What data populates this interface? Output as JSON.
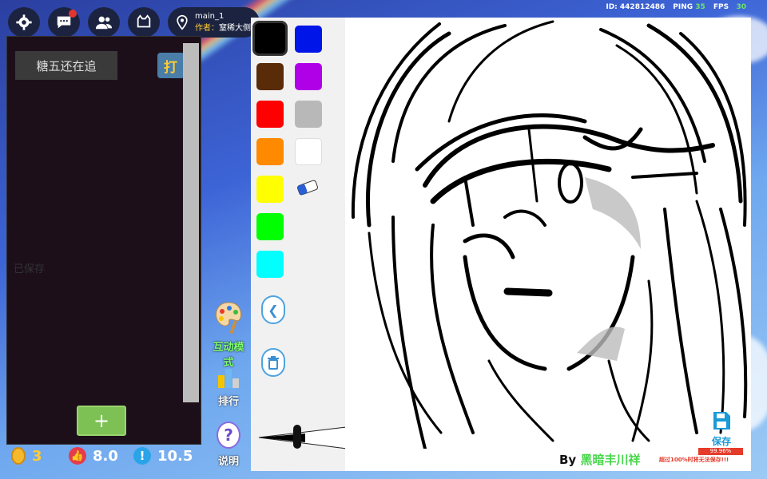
{
  "top_bar": {
    "icons": [
      "gear-icon",
      "chat-icon",
      "friends-icon",
      "cat-face-icon",
      "map-pin-icon"
    ],
    "map_name": "main_1",
    "author_label": "作者：",
    "author_name": "窒稀大侧"
  },
  "status": {
    "id_text": "ID: 442812486",
    "ping_label": "PING",
    "ping_value": "35",
    "fps_label": "FPS",
    "fps_value": "30"
  },
  "chat_panel": {
    "name": "糖五还在追",
    "action_button": "打",
    "saved_text": "已保存",
    "add_button": "+"
  },
  "stats": {
    "coins": "3",
    "likes": "8.0",
    "warning": "10.5"
  },
  "side_buttons": {
    "interactive": "互动模式",
    "ranking": "排行",
    "help": "说明"
  },
  "palette": {
    "colors": [
      "#000000",
      "#0015e8",
      "#5a2b08",
      "#b000e8",
      "#ff0000",
      "#b8b8b8",
      "#ff8a00",
      "#ffffff",
      "#ffff00",
      "#00ff00",
      "#00ffff"
    ],
    "selected_color": "#000000",
    "tools": [
      "eraser-icon",
      "back-icon",
      "trash-icon"
    ]
  },
  "canvas": {
    "byline_prefix": "By ",
    "byline_name": "黑暗丰川祥",
    "save_label": "保存",
    "progress": "99.96%",
    "progress_fraction": 0.9996,
    "warning": "超过100%时将无法保存!!!"
  }
}
